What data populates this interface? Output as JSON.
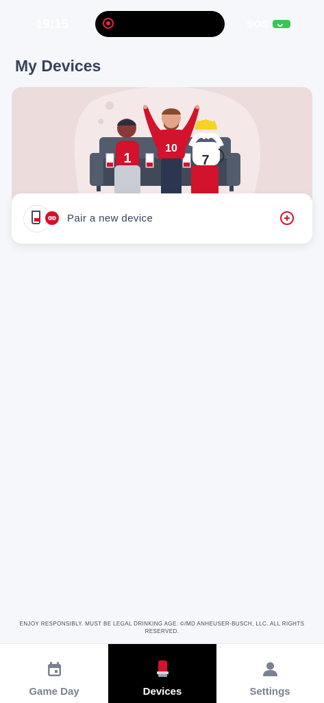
{
  "status_bar": {
    "time": "19:15",
    "network": "SOS"
  },
  "page": {
    "title": "My Devices"
  },
  "pair_card": {
    "label": "Pair a new device"
  },
  "hero": {
    "jersey_numbers": [
      "1",
      "10",
      "7"
    ]
  },
  "footer": {
    "legal": "ENJOY RESPONSIBLY. MUST BE LEGAL DRINKING AGE. ©/MD ANHEUSER-BUSCH, LLC. ALL RIGHTS RESERVED."
  },
  "tab_bar": {
    "active": "Devices",
    "tabs": [
      {
        "label": "Game Day",
        "icon": "calendar-icon"
      },
      {
        "label": "Devices",
        "icon": "goal-light-icon"
      },
      {
        "label": "Settings",
        "icon": "person-icon"
      }
    ]
  },
  "colors": {
    "accent": "#d3122b",
    "title": "#34425b",
    "background": "#f6f7fa"
  }
}
